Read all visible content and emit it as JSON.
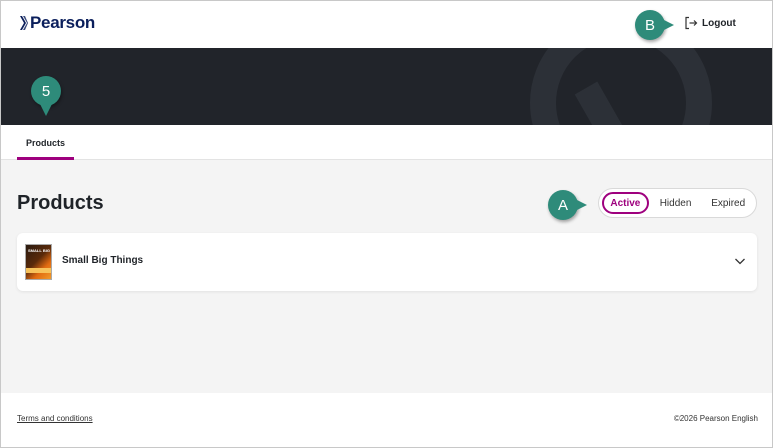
{
  "header": {
    "logo_text": "Pearson",
    "logout_label": "Logout"
  },
  "tabs": [
    {
      "label": "Products",
      "active": true
    }
  ],
  "main": {
    "title": "Products",
    "filters": [
      {
        "label": "Active",
        "selected": true
      },
      {
        "label": "Hidden",
        "selected": false
      },
      {
        "label": "Expired",
        "selected": false
      }
    ],
    "products": [
      {
        "title": "Small Big Things",
        "cover_text": "SMALL BIG"
      }
    ]
  },
  "footer": {
    "terms_label": "Terms and conditions",
    "copyright": "©2026 Pearson English"
  },
  "callouts": {
    "b": "B",
    "a": "A",
    "five": "5"
  },
  "colors": {
    "accent": "#9e007e",
    "banner": "#21242a",
    "callout": "#2e8b7a",
    "brand_navy": "#0b1f5c"
  },
  "icons": {
    "logo": "pearson-logo-icon",
    "logout": "logout-icon",
    "expand": "chevron-down-icon"
  }
}
